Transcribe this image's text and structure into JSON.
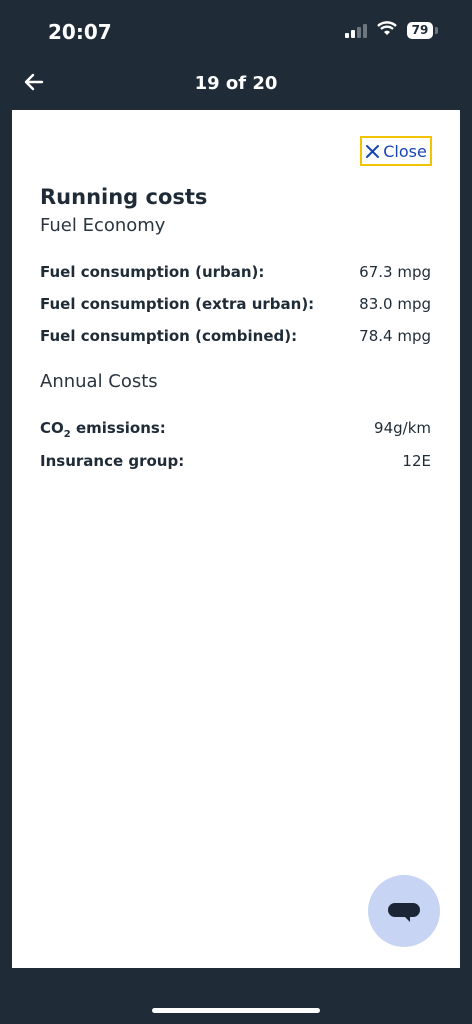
{
  "status_bar": {
    "time": "20:07",
    "battery": "79"
  },
  "header": {
    "counter": "19 of 20"
  },
  "panel": {
    "close_label": "Close",
    "title": "Running costs",
    "fuel_economy": {
      "heading": "Fuel Economy",
      "rows": [
        {
          "label": "Fuel consumption (urban):",
          "value": "67.3 mpg"
        },
        {
          "label": "Fuel consumption (extra urban):",
          "value": "83.0 mpg"
        },
        {
          "label": "Fuel consumption (combined):",
          "value": "78.4 mpg"
        }
      ]
    },
    "annual_costs": {
      "heading": "Annual Costs",
      "co2_label_prefix": "CO",
      "co2_label_sub": "2",
      "co2_label_suffix": " emissions:",
      "co2_value": "94g/km",
      "insurance_label": "Insurance group:",
      "insurance_value": "12E"
    }
  },
  "colors": {
    "background": "#1f2c38",
    "close_border": "#f2c300",
    "link": "#1844b5",
    "fab": "#c7d4f3"
  },
  "icons": [
    "back-arrow-icon",
    "close-icon",
    "chat-icon",
    "wifi-icon",
    "signal-icon"
  ]
}
